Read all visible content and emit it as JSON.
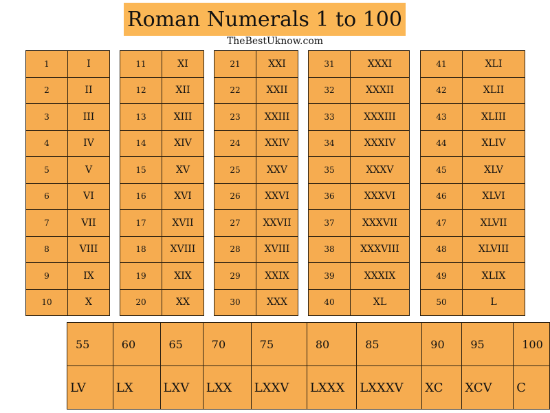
{
  "title": "Roman Numerals 1 to 100",
  "subtitle": "TheBestUknow.com",
  "tables": [
    {
      "rows": [
        [
          "1",
          "I"
        ],
        [
          "2",
          "II"
        ],
        [
          "3",
          "III"
        ],
        [
          "4",
          "IV"
        ],
        [
          "5",
          "V"
        ],
        [
          "6",
          "VI"
        ],
        [
          "7",
          "VII"
        ],
        [
          "8",
          "VIII"
        ],
        [
          "9",
          "IX"
        ],
        [
          "10",
          "X"
        ]
      ]
    },
    {
      "rows": [
        [
          "11",
          "XI"
        ],
        [
          "12",
          "XII"
        ],
        [
          "13",
          "XIII"
        ],
        [
          "14",
          "XIV"
        ],
        [
          "15",
          "XV"
        ],
        [
          "16",
          "XVI"
        ],
        [
          "17",
          "XVII"
        ],
        [
          "18",
          "XVIII"
        ],
        [
          "19",
          "XIX"
        ],
        [
          "20",
          "XX"
        ]
      ]
    },
    {
      "rows": [
        [
          "21",
          "XXI"
        ],
        [
          "22",
          "XXII"
        ],
        [
          "23",
          "XXIII"
        ],
        [
          "24",
          "XXIV"
        ],
        [
          "25",
          "XXV"
        ],
        [
          "26",
          "XXVI"
        ],
        [
          "27",
          "XXVII"
        ],
        [
          "28",
          "XVIII"
        ],
        [
          "29",
          "XXIX"
        ],
        [
          "30",
          "XXX"
        ]
      ]
    },
    {
      "rows": [
        [
          "31",
          "XXXI"
        ],
        [
          "32",
          "XXXII"
        ],
        [
          "33",
          "XXXIII"
        ],
        [
          "34",
          "XXXIV"
        ],
        [
          "35",
          "XXXV"
        ],
        [
          "36",
          "XXXVI"
        ],
        [
          "37",
          "XXXVII"
        ],
        [
          "38",
          "XXXVIII"
        ],
        [
          "39",
          "XXXIX"
        ],
        [
          "40",
          "XL"
        ]
      ]
    },
    {
      "rows": [
        [
          "41",
          "XLI"
        ],
        [
          "42",
          "XLII"
        ],
        [
          "43",
          "XLIII"
        ],
        [
          "44",
          "XLIV"
        ],
        [
          "45",
          "XLV"
        ],
        [
          "46",
          "XLVI"
        ],
        [
          "47",
          "XLVII"
        ],
        [
          "48",
          "XLVIII"
        ],
        [
          "49",
          "XLIX"
        ],
        [
          "50",
          "L"
        ]
      ]
    }
  ],
  "bottom": {
    "numbers": [
      "55",
      "60",
      "65",
      "70",
      "75",
      "80",
      "85",
      "90",
      "95",
      "100"
    ],
    "romans": [
      "LV",
      "LX",
      "LXV",
      "LXX",
      "LXXV",
      "LXXX",
      "LXXXV",
      "XC",
      "XCV",
      "C"
    ]
  },
  "colors": {
    "title_bg": "#fbb756",
    "cell_bg": "#f6ac50",
    "border": "#2a1f10"
  }
}
